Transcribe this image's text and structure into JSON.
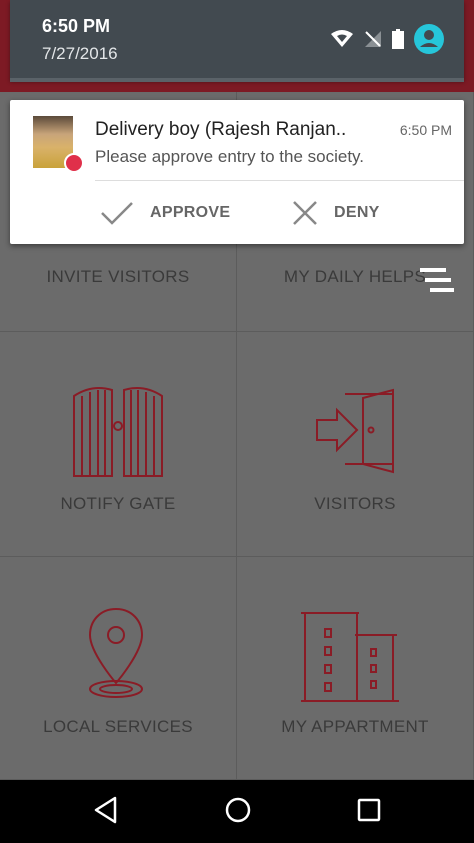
{
  "status_bar": {
    "time": "6:50 PM",
    "date": "7/27/2016"
  },
  "notification": {
    "title": "Delivery boy (Rajesh Ranjan..",
    "time": "6:50 PM",
    "text": "Please approve entry to the society.",
    "approve_label": "APPROVE",
    "deny_label": "DENY"
  },
  "grid": {
    "invite_visitors": "INVITE VISITORS",
    "my_daily_helps": "MY DAILY HELPS",
    "notify_gate": "NOTIFY GATE",
    "visitors": "VISITORS",
    "local_services": "LOCAL SERVICES",
    "my_appartment": "MY APPARTMENT"
  },
  "colors": {
    "accent": "#8a1c26",
    "notification_badge": "#e0304a",
    "account_icon": "#26c6da"
  }
}
